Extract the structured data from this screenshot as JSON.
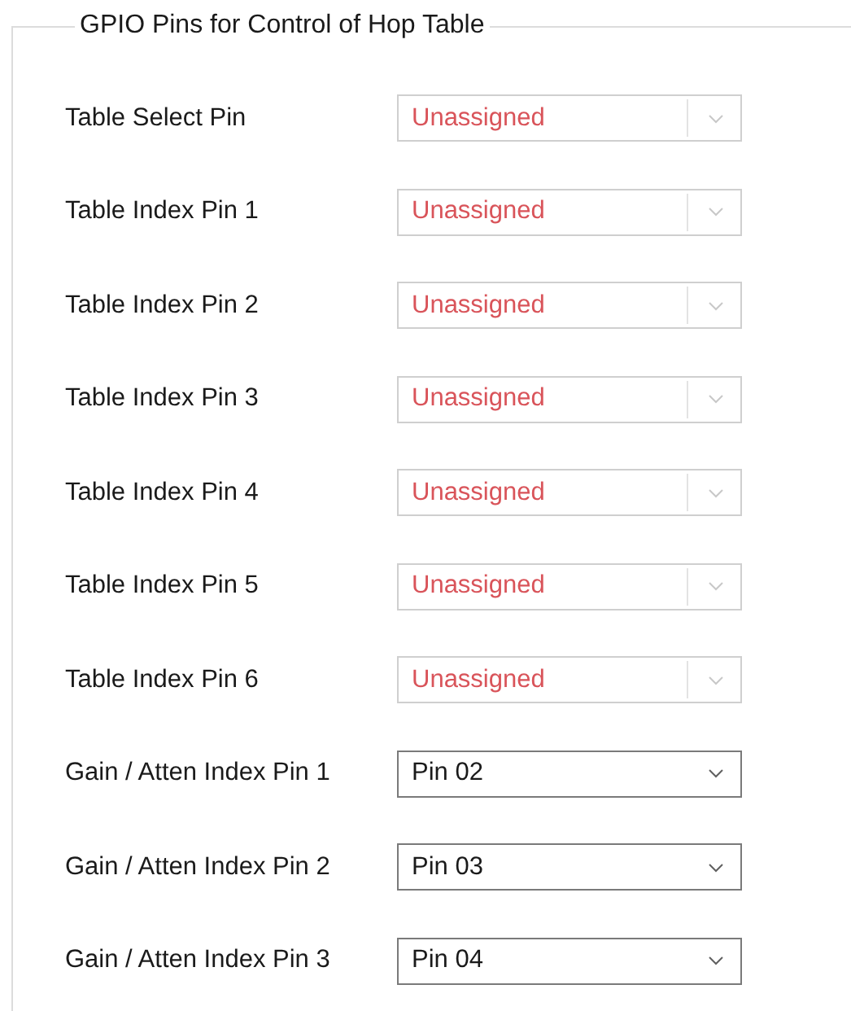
{
  "group": {
    "title": "GPIO Pins for Control of Hop Table",
    "pins": [
      {
        "label": "Table Select Pin",
        "value": "Unassigned",
        "disabled": true
      },
      {
        "label": "Table Index Pin 1",
        "value": "Unassigned",
        "disabled": true
      },
      {
        "label": "Table Index Pin 2",
        "value": "Unassigned",
        "disabled": true
      },
      {
        "label": "Table Index Pin 3",
        "value": "Unassigned",
        "disabled": true
      },
      {
        "label": "Table Index Pin 4",
        "value": "Unassigned",
        "disabled": true
      },
      {
        "label": "Table Index Pin 5",
        "value": "Unassigned",
        "disabled": true
      },
      {
        "label": "Table Index Pin 6",
        "value": "Unassigned",
        "disabled": true
      },
      {
        "label": "Gain / Atten Index Pin 1",
        "value": "Pin 02",
        "disabled": false
      },
      {
        "label": "Gain / Atten Index Pin 2",
        "value": "Pin 03",
        "disabled": false
      },
      {
        "label": "Gain / Atten Index Pin 3",
        "value": "Pin 04",
        "disabled": false
      }
    ]
  }
}
